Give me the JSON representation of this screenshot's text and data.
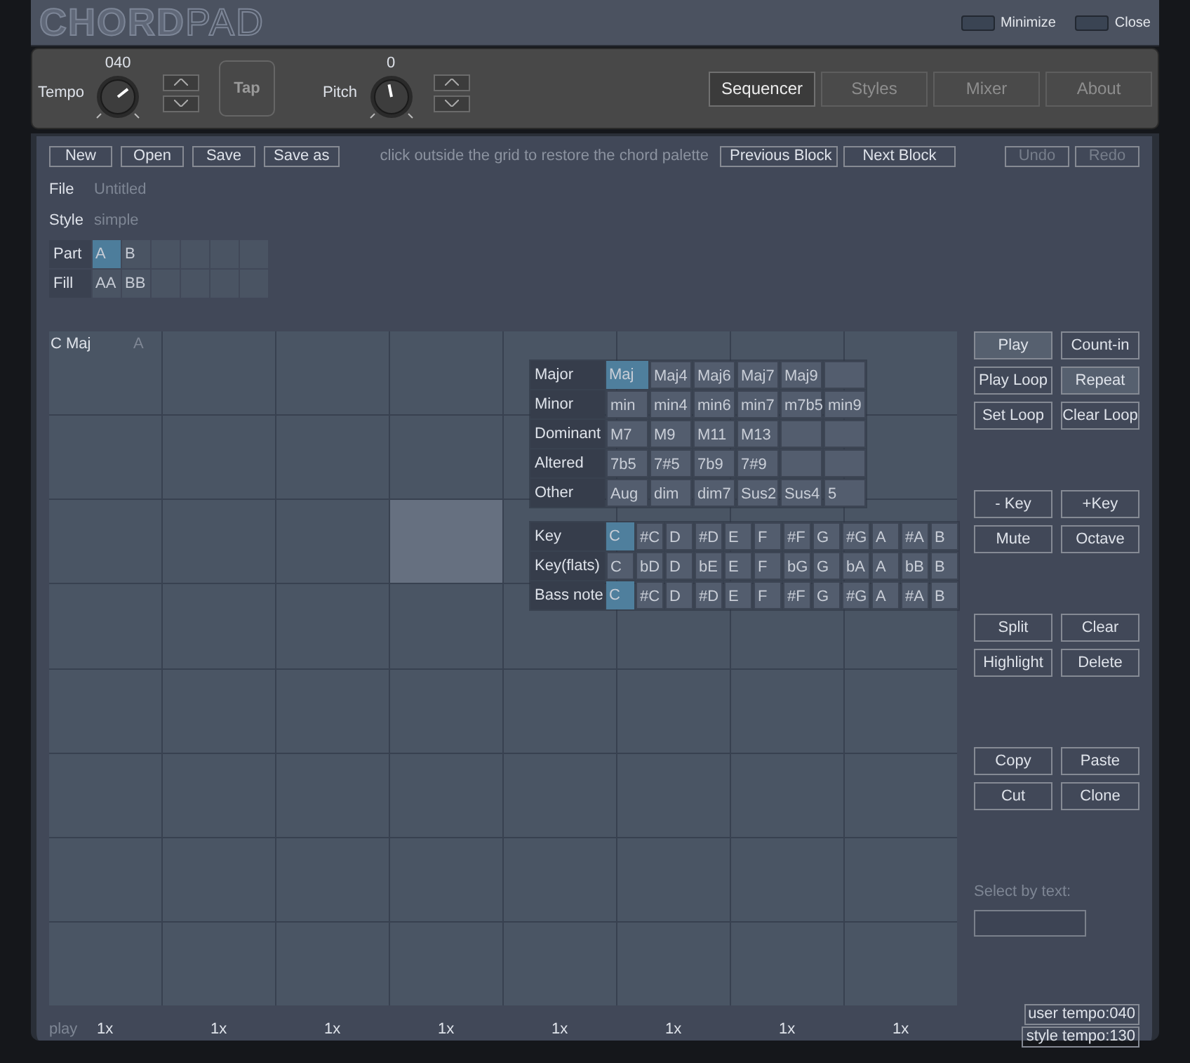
{
  "window": {
    "logo": [
      "CHORD",
      "PAD"
    ],
    "controls": [
      "Minimize",
      "Close"
    ]
  },
  "toolbar": {
    "tempo": {
      "label": "Tempo",
      "value": "040"
    },
    "tap": "Tap",
    "pitch": {
      "label": "Pitch",
      "value": "0"
    },
    "tabs": [
      {
        "label": "Sequencer",
        "selected": true
      },
      {
        "label": "Styles",
        "selected": false
      },
      {
        "label": "Mixer",
        "selected": false
      },
      {
        "label": "About",
        "selected": false
      }
    ]
  },
  "file_buttons": [
    "New",
    "Open",
    "Save",
    "Save as"
  ],
  "hint": "click outside the grid to restore the chord palette",
  "block_buttons": [
    "Previous Block",
    "Next Block"
  ],
  "history_buttons": [
    {
      "label": "Undo",
      "disabled": true
    },
    {
      "label": "Redo",
      "disabled": true
    }
  ],
  "info": [
    {
      "label": "File",
      "value": "Untitled"
    },
    {
      "label": "Style",
      "value": "simple"
    }
  ],
  "parts": [
    {
      "label": "Part",
      "cells": [
        {
          "text": "A",
          "selected": true
        },
        {
          "text": "B",
          "selected": false
        },
        {
          "selected": false
        },
        {
          "selected": false
        },
        {
          "selected": false
        },
        {
          "selected": false
        }
      ]
    },
    {
      "label": "Fill",
      "cells": [
        {
          "text": "AA",
          "selected": false
        },
        {
          "text": "BB",
          "selected": false
        },
        {
          "selected": false
        },
        {
          "selected": false
        },
        {
          "selected": false
        },
        {
          "selected": false
        }
      ]
    }
  ],
  "grid": {
    "rows": [
      {
        "cells": [
          {
            "chord": "C Maj",
            "part": "A",
            "selected": false
          },
          {
            "selected": false
          },
          {
            "selected": false
          },
          {
            "selected": false
          },
          {
            "selected": false
          },
          {
            "selected": false
          },
          {
            "selected": false
          },
          {
            "selected": false
          }
        ]
      },
      {
        "cells": [
          {
            "selected": false
          },
          {
            "selected": false
          },
          {
            "selected": false
          },
          {
            "selected": false
          },
          {
            "selected": false
          },
          {
            "selected": false
          },
          {
            "selected": false
          },
          {
            "selected": false
          }
        ]
      },
      {
        "cells": [
          {
            "selected": false
          },
          {
            "selected": false
          },
          {
            "selected": false
          },
          {
            "selected": true
          },
          {
            "selected": false
          },
          {
            "selected": false
          },
          {
            "selected": false
          },
          {
            "selected": false
          }
        ]
      },
      {
        "cells": [
          {
            "selected": false
          },
          {
            "selected": false
          },
          {
            "selected": false
          },
          {
            "selected": false
          },
          {
            "selected": false
          },
          {
            "selected": false
          },
          {
            "selected": false
          },
          {
            "selected": false
          }
        ]
      },
      {
        "cells": [
          {
            "selected": false
          },
          {
            "selected": false
          },
          {
            "selected": false
          },
          {
            "selected": false
          },
          {
            "selected": false
          },
          {
            "selected": false
          },
          {
            "selected": false
          },
          {
            "selected": false
          }
        ]
      },
      {
        "cells": [
          {
            "selected": false
          },
          {
            "selected": false
          },
          {
            "selected": false
          },
          {
            "selected": false
          },
          {
            "selected": false
          },
          {
            "selected": false
          },
          {
            "selected": false
          },
          {
            "selected": false
          }
        ]
      },
      {
        "cells": [
          {
            "selected": false
          },
          {
            "selected": false
          },
          {
            "selected": false
          },
          {
            "selected": false
          },
          {
            "selected": false
          },
          {
            "selected": false
          },
          {
            "selected": false
          },
          {
            "selected": false
          }
        ]
      },
      {
        "cells": [
          {
            "selected": false
          },
          {
            "selected": false
          },
          {
            "selected": false
          },
          {
            "selected": false
          },
          {
            "selected": false
          },
          {
            "selected": false
          },
          {
            "selected": false
          },
          {
            "selected": false
          }
        ]
      }
    ],
    "play_label": "play",
    "repeats": [
      "1x",
      "1x",
      "1x",
      "1x",
      "1x",
      "1x",
      "1x",
      "1x"
    ]
  },
  "chord_palette": [
    {
      "label": "Major",
      "cells": [
        {
          "text": "Maj",
          "selected": true
        },
        {
          "text": "Maj4",
          "selected": false
        },
        {
          "text": "Maj6",
          "selected": false
        },
        {
          "text": "Maj7",
          "selected": false
        },
        {
          "text": "Maj9",
          "selected": false
        },
        {
          "selected": false
        }
      ]
    },
    {
      "label": "Minor",
      "cells": [
        {
          "text": "min",
          "selected": false
        },
        {
          "text": "min4",
          "selected": false
        },
        {
          "text": "min6",
          "selected": false
        },
        {
          "text": "min7",
          "selected": false
        },
        {
          "text": "m7b5",
          "selected": false
        },
        {
          "text": "min9",
          "selected": false
        }
      ]
    },
    {
      "label": "Dominant",
      "cells": [
        {
          "text": "M7",
          "selected": false
        },
        {
          "text": "M9",
          "selected": false
        },
        {
          "text": "M11",
          "selected": false
        },
        {
          "text": "M13",
          "selected": false
        },
        {
          "selected": false
        },
        {
          "selected": false
        }
      ]
    },
    {
      "label": "Altered",
      "cells": [
        {
          "text": "7b5",
          "selected": false
        },
        {
          "text": "7#5",
          "selected": false
        },
        {
          "text": "7b9",
          "selected": false
        },
        {
          "text": "7#9",
          "selected": false
        },
        {
          "selected": false
        },
        {
          "selected": false
        }
      ]
    },
    {
      "label": "Other",
      "cells": [
        {
          "text": "Aug",
          "selected": false
        },
        {
          "text": "dim",
          "selected": false
        },
        {
          "text": "dim7",
          "selected": false
        },
        {
          "text": "Sus2",
          "selected": false
        },
        {
          "text": "Sus4",
          "selected": false
        },
        {
          "text": "5",
          "selected": false
        }
      ]
    }
  ],
  "key_palette": [
    {
      "label": "Key",
      "cells": [
        {
          "text": "C",
          "selected": true
        },
        {
          "text": "#C",
          "selected": false
        },
        {
          "text": "D",
          "selected": false
        },
        {
          "text": "#D",
          "selected": false
        },
        {
          "text": "E",
          "selected": false
        },
        {
          "text": "F",
          "selected": false
        },
        {
          "text": "#F",
          "selected": false
        },
        {
          "text": "G",
          "selected": false
        },
        {
          "text": "#G",
          "selected": false
        },
        {
          "text": "A",
          "selected": false
        },
        {
          "text": "#A",
          "selected": false
        },
        {
          "text": "B",
          "selected": false
        }
      ]
    },
    {
      "label": "Key(flats)",
      "cells": [
        {
          "text": "C",
          "selected": false
        },
        {
          "text": "bD",
          "selected": false
        },
        {
          "text": "D",
          "selected": false
        },
        {
          "text": "bE",
          "selected": false
        },
        {
          "text": "E",
          "selected": false
        },
        {
          "text": "F",
          "selected": false
        },
        {
          "text": "bG",
          "selected": false
        },
        {
          "text": "G",
          "selected": false
        },
        {
          "text": "bA",
          "selected": false
        },
        {
          "text": "A",
          "selected": false
        },
        {
          "text": "bB",
          "selected": false
        },
        {
          "text": "B",
          "selected": false
        }
      ]
    },
    {
      "label": "Bass note",
      "cells": [
        {
          "text": "C",
          "selected": true
        },
        {
          "text": "#C",
          "selected": false
        },
        {
          "text": "D",
          "selected": false
        },
        {
          "text": "#D",
          "selected": false
        },
        {
          "text": "E",
          "selected": false
        },
        {
          "text": "F",
          "selected": false
        },
        {
          "text": "#F",
          "selected": false
        },
        {
          "text": "G",
          "selected": false
        },
        {
          "text": "#G",
          "selected": false
        },
        {
          "text": "A",
          "selected": false
        },
        {
          "text": "#A",
          "selected": false
        },
        {
          "text": "B",
          "selected": false
        }
      ]
    }
  ],
  "side_button_groups": [
    [
      {
        "label": "Play",
        "on": true
      },
      {
        "label": "Count-in",
        "on": false
      },
      {
        "label": "Play Loop",
        "on": false
      },
      {
        "label": "Repeat",
        "on": true
      },
      {
        "label": "Set Loop",
        "on": false
      },
      {
        "label": "Clear Loop",
        "on": false
      }
    ],
    [
      {
        "label": "- Key",
        "on": false
      },
      {
        "label": "+Key",
        "on": false
      },
      {
        "label": "Mute",
        "on": false
      },
      {
        "label": "Octave",
        "on": false
      }
    ],
    [
      {
        "label": "Split",
        "on": false
      },
      {
        "label": "Clear",
        "on": false
      },
      {
        "label": "Highlight",
        "on": false
      },
      {
        "label": "Delete",
        "on": false
      }
    ],
    [
      {
        "label": "Copy",
        "on": false
      },
      {
        "label": "Paste",
        "on": false
      },
      {
        "label": "Cut",
        "on": false
      },
      {
        "label": "Clone",
        "on": false
      }
    ]
  ],
  "select_by_text": {
    "label": "Select by text:"
  },
  "status": [
    "user tempo:040",
    "style tempo:130"
  ]
}
